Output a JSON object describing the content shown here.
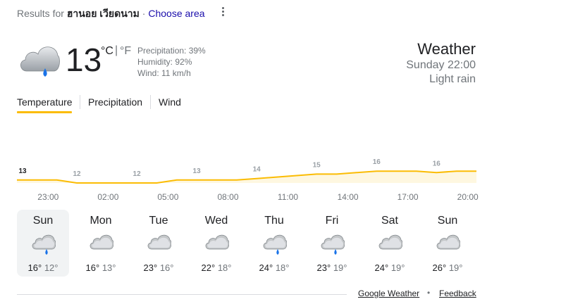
{
  "header": {
    "prefix": "Results for",
    "location": "ฮานอย เวียดนาม",
    "separator": "·",
    "choose_area": "Choose area"
  },
  "current": {
    "temp": "13",
    "unit_c": "°C",
    "unit_sep": "|",
    "unit_f": "°F",
    "precipitation": "Precipitation: 39%",
    "humidity": "Humidity: 92%",
    "wind": "Wind: 11 km/h",
    "icon": "rain-cloud-icon"
  },
  "summary": {
    "title": "Weather",
    "time": "Sunday 22:00",
    "condition": "Light rain"
  },
  "tabs": {
    "temperature": "Temperature",
    "precipitation": "Precipitation",
    "wind": "Wind",
    "selected": "temperature"
  },
  "chart_data": {
    "type": "area",
    "title": "",
    "xlabel": "",
    "ylabel": "",
    "x": [
      "22:00",
      "23:00",
      "00:00",
      "01:00",
      "02:00",
      "03:00",
      "04:00",
      "05:00",
      "06:00",
      "07:00",
      "08:00",
      "09:00",
      "10:00",
      "11:00",
      "12:00",
      "13:00",
      "14:00",
      "15:00",
      "16:00",
      "17:00",
      "18:00",
      "19:00",
      "20:00",
      "21:00"
    ],
    "values": [
      13,
      13,
      13,
      12,
      12,
      12,
      12,
      12,
      13,
      13,
      13,
      13,
      13.5,
      14,
      14.5,
      15,
      15,
      15.5,
      16,
      16,
      16,
      15.5,
      16,
      16
    ],
    "labels_every": 3,
    "hour_labels": [
      "23:00",
      "02:00",
      "05:00",
      "08:00",
      "11:00",
      "14:00",
      "17:00",
      "20:00"
    ],
    "ylim": [
      0,
      16
    ],
    "colors": {
      "line": "#fbbc04",
      "fill": "#fef7e0"
    }
  },
  "days": [
    {
      "name": "Sun",
      "hi": "16°",
      "lo": "12°",
      "icon": "rain-cloud-icon",
      "selected": true
    },
    {
      "name": "Mon",
      "hi": "16°",
      "lo": "13°",
      "icon": "cloud-icon",
      "selected": false
    },
    {
      "name": "Tue",
      "hi": "23°",
      "lo": "16°",
      "icon": "cloud-icon",
      "selected": false
    },
    {
      "name": "Wed",
      "hi": "22°",
      "lo": "18°",
      "icon": "cloud-icon",
      "selected": false
    },
    {
      "name": "Thu",
      "hi": "24°",
      "lo": "18°",
      "icon": "rain-cloud-icon",
      "selected": false
    },
    {
      "name": "Fri",
      "hi": "23°",
      "lo": "19°",
      "icon": "rain-cloud-icon",
      "selected": false
    },
    {
      "name": "Sat",
      "hi": "24°",
      "lo": "19°",
      "icon": "cloud-icon",
      "selected": false
    },
    {
      "name": "Sun",
      "hi": "26°",
      "lo": "19°",
      "icon": "cloud-icon",
      "selected": false
    }
  ],
  "footer": {
    "google_weather": "Google Weather",
    "bullet": "•",
    "feedback": "Feedback"
  }
}
